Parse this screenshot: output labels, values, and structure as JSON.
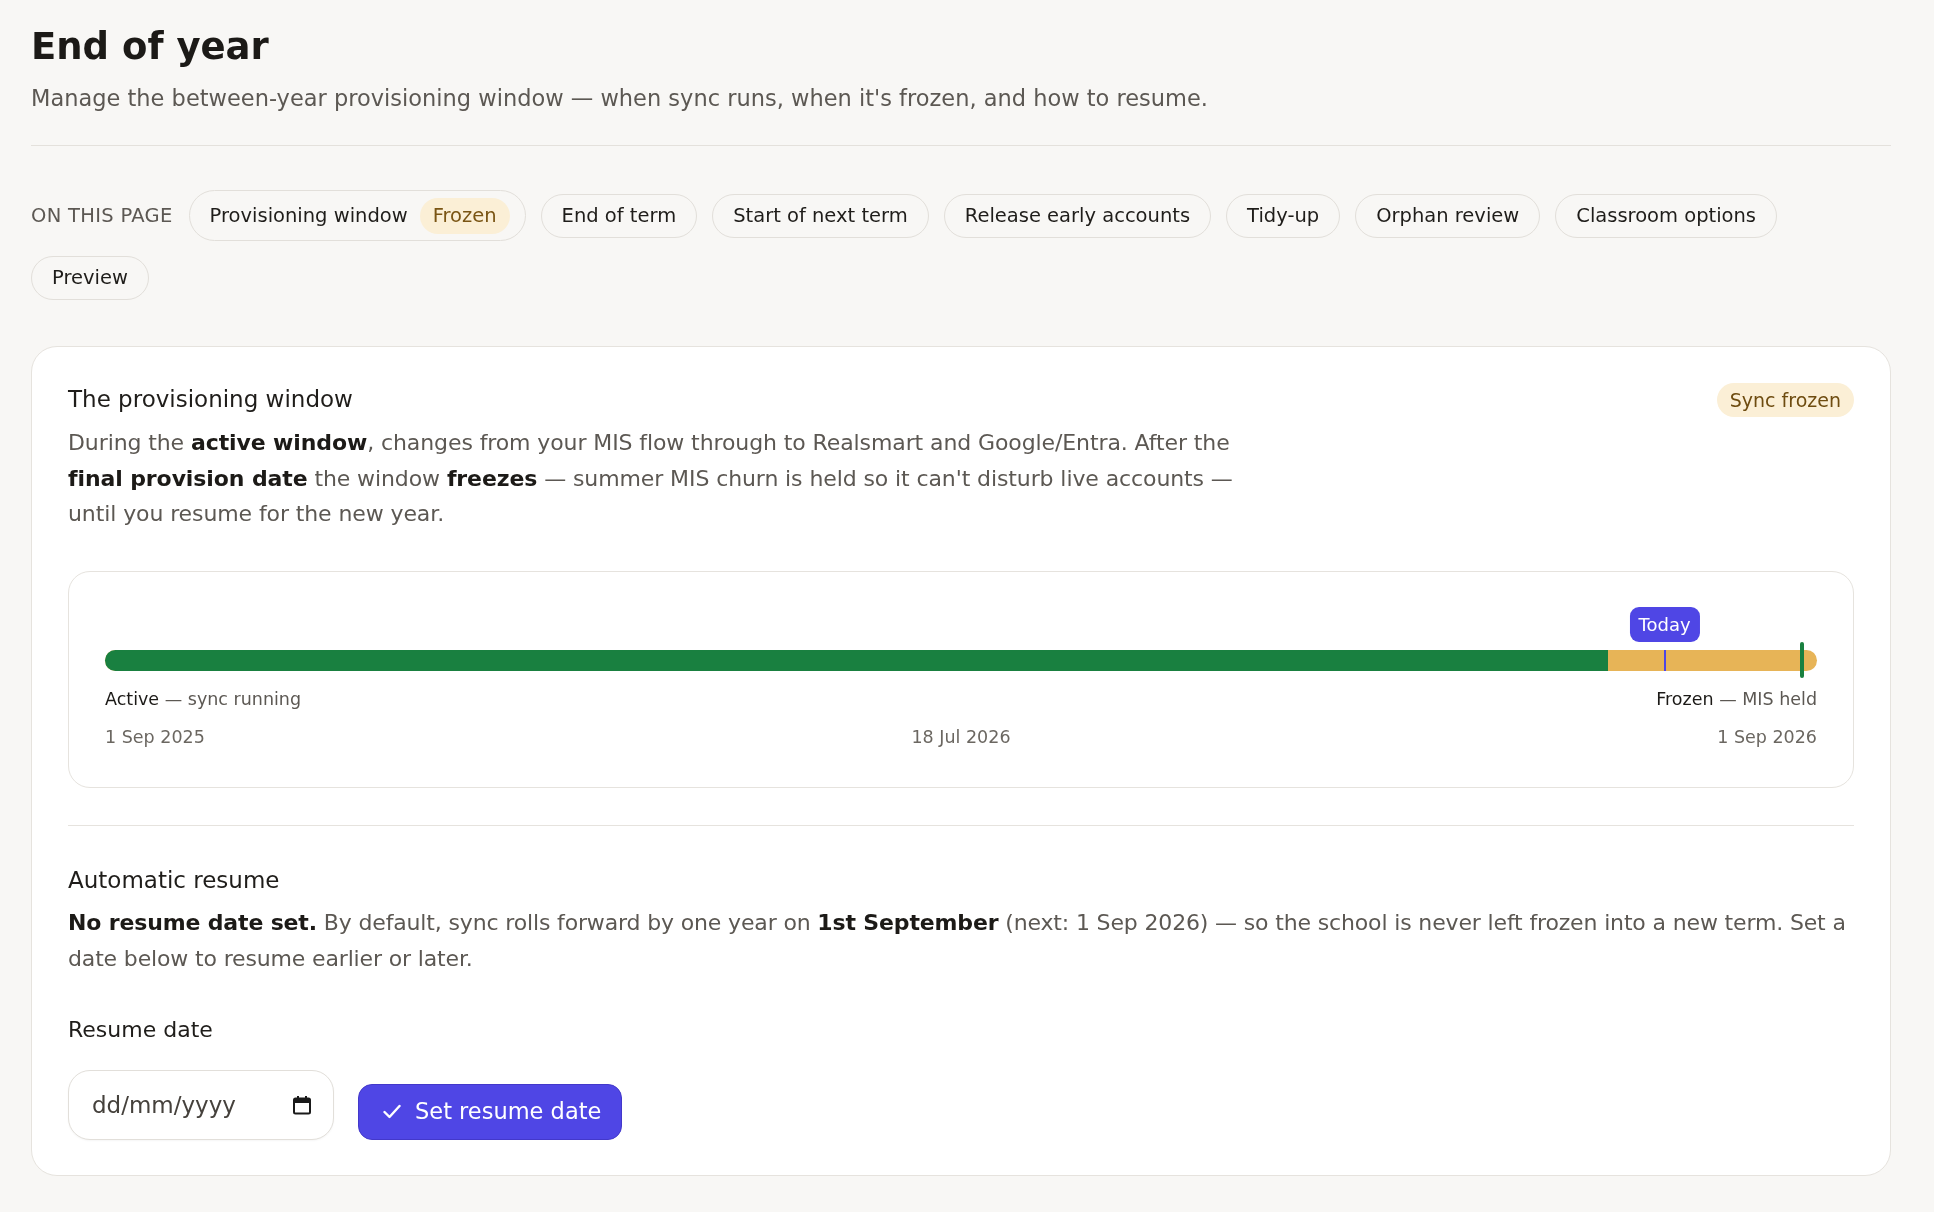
{
  "page": {
    "title": "End of year",
    "subtitle": "Manage the between-year provisioning window — when sync runs, when it's frozen, and how to resume."
  },
  "on_this_page": {
    "label": "ON THIS PAGE",
    "links": [
      {
        "label": "Provisioning window",
        "badge": "Frozen"
      },
      {
        "label": "End of term"
      },
      {
        "label": "Start of next term"
      },
      {
        "label": "Release early accounts"
      },
      {
        "label": "Tidy-up"
      },
      {
        "label": "Orphan review"
      },
      {
        "label": "Classroom options"
      },
      {
        "label": "Preview"
      }
    ]
  },
  "provisioning_window": {
    "title": "The provisioning window",
    "status_badge": "Sync frozen",
    "description": "During the **active window**, changes from your MIS flow through to Realsmart and Google/Entra. After the **final provision date** the window **freezes** — summer MIS churn is held so it can't disturb live accounts — until you resume for the new year.",
    "timeline": {
      "level": 0.878,
      "markers": [
        {
          "kind": "today",
          "label": "Today",
          "level": 0.911
        },
        {
          "kind": "end",
          "level": 0.991
        }
      ],
      "start_legend": "**Active** — sync running",
      "end_legend": "**Frozen** — MIS held",
      "dates": [
        "1 Sep 2025",
        "18 Jul 2026",
        "1 Sep 2026"
      ]
    }
  },
  "automatic_resume": {
    "title": "Automatic resume",
    "description": "**No resume date set.** By default, sync rolls forward by one year on **1st September** (next: 1 Sep 2026) — so the school is never left frozen into a new term. Set a date below to resume earlier or later.",
    "field": {
      "label": "Resume date",
      "placeholder": "dd/mm/yyyy"
    },
    "button": "Set resume date"
  }
}
